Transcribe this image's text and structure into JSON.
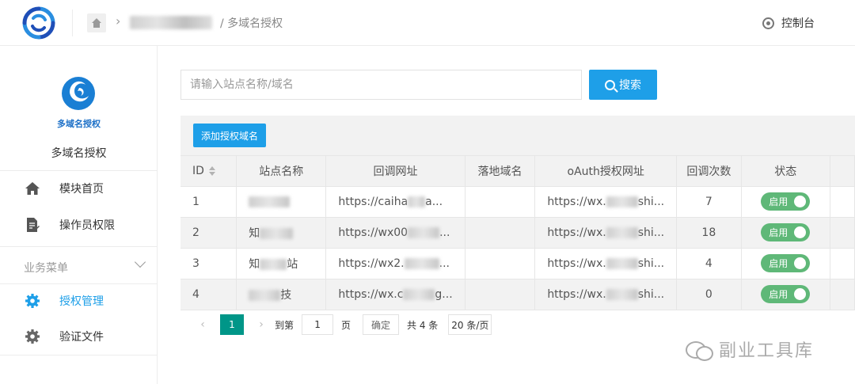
{
  "breadcrumb": {
    "current": "/ 多域名授权"
  },
  "header": {
    "console_label": "控制台"
  },
  "sidebar": {
    "brand_text": "多域名授权",
    "site_name": "多域名授权",
    "items": [
      {
        "label": "模块首页",
        "icon": "home-icon"
      },
      {
        "label": "操作员权限",
        "icon": "document-edit-icon"
      }
    ],
    "group_label": "业务菜单",
    "group_items": [
      {
        "label": "授权管理",
        "icon": "gear-icon",
        "active": true
      },
      {
        "label": "验证文件",
        "icon": "gear-icon",
        "active": false
      }
    ]
  },
  "search": {
    "placeholder": "请输入站点名称/域名",
    "button_label": "搜索"
  },
  "toolbar": {
    "add_label": "添加授权域名"
  },
  "table": {
    "headers": [
      "ID",
      "站点名称",
      "回调网址",
      "落地域名",
      "oAuth授权网址",
      "回调次数",
      "状态"
    ],
    "rows": [
      {
        "id": "1",
        "name_prefix": "",
        "name_suffix": "",
        "callback": "https://caiha",
        "callback_tail": "a...",
        "landing": "",
        "oauth": "https://wx.",
        "oauth_tail": "shi...",
        "count": "7",
        "status": "启用"
      },
      {
        "id": "2",
        "name_prefix": "知",
        "name_suffix": "",
        "callback": "https://wx00",
        "callback_tail": "...",
        "landing": "",
        "oauth": "https://wx.",
        "oauth_tail": "shi...",
        "count": "18",
        "status": "启用"
      },
      {
        "id": "3",
        "name_prefix": "知",
        "name_suffix": "站",
        "callback": "https://wx2.",
        "callback_tail": "...",
        "landing": "",
        "oauth": "https://wx.",
        "oauth_tail": "shi...",
        "count": "4",
        "status": "启用"
      },
      {
        "id": "4",
        "name_prefix": "",
        "name_suffix": "技",
        "callback": "https://wx.c",
        "callback_tail": "g...",
        "landing": "",
        "oauth": "https://wx.",
        "oauth_tail": "shi...",
        "count": "0",
        "status": "启用"
      }
    ]
  },
  "pager": {
    "current": "1",
    "goto_label": "到第",
    "goto_value": "1",
    "page_label": "页",
    "ok_label": "确定",
    "total": "共 4 条",
    "page_size": "20 条/页"
  },
  "watermark": "副业工具库",
  "colors": {
    "primary": "#1e9fe8",
    "pager_active": "#009688",
    "toggle_on": "#5fb878"
  }
}
